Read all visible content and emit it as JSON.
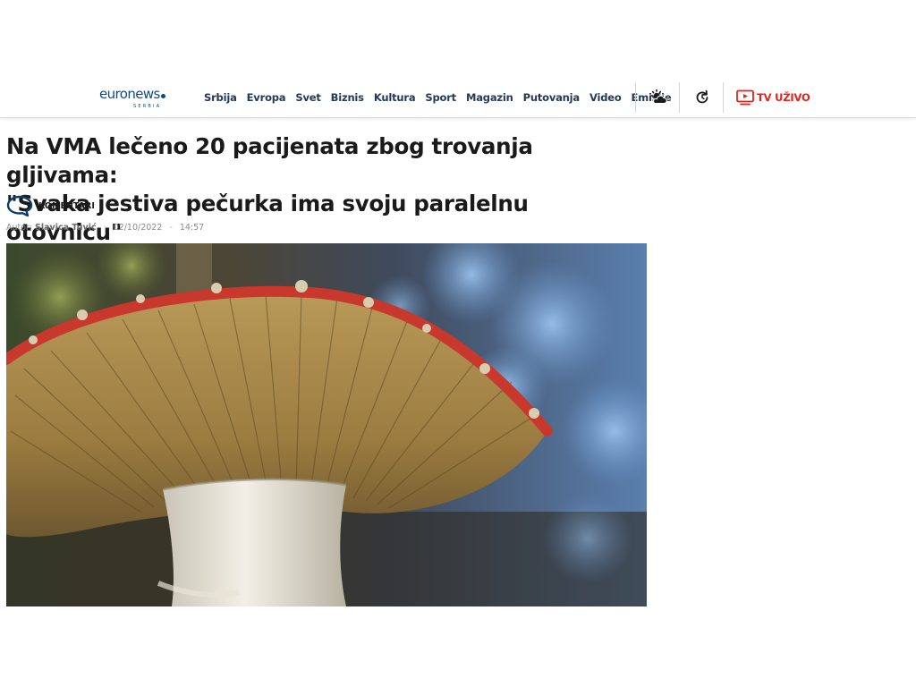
{
  "header": {
    "logo": {
      "text": "euronews",
      "sub": "SERBIA"
    },
    "nav": [
      "Srbija",
      "Evropa",
      "Svet",
      "Biznis",
      "Kultura",
      "Sport",
      "Magazin",
      "Putovanja",
      "Video",
      "Emisije"
    ],
    "tv_live_label": "TV UŽIVO",
    "icons": [
      "weather-icon",
      "refresh-icon",
      "tv-icon"
    ],
    "accent_color": "#e2231a",
    "brand_color": "#0b4b86"
  },
  "article": {
    "title_line1": "Na VMA lečeno 20 pacijenata zbog trovanja gljivama:",
    "title_line2": "\"Svaka jestiva pečurka ima svoju paralelnu otovnicu\"",
    "comments_label": "KOMENTARI",
    "author_prefix": "Autor:",
    "author": "Slavica Tuvić",
    "date": "02/10/2022",
    "time": "14:57"
  }
}
